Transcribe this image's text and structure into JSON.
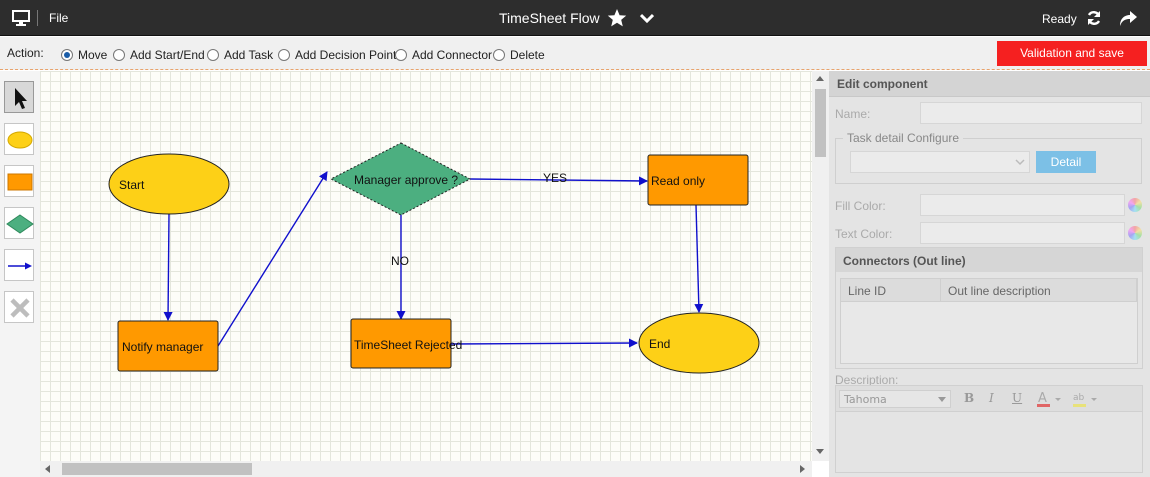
{
  "topbar": {
    "file_label": "File",
    "title": "TimeSheet Flow",
    "status": "Ready"
  },
  "actionbar": {
    "label": "Action:",
    "options": [
      {
        "label": "Move",
        "selected": true
      },
      {
        "label": "Add Start/End",
        "selected": false
      },
      {
        "label": "Add Task",
        "selected": false
      },
      {
        "label": "Add Decision Point",
        "selected": false
      },
      {
        "label": "Add Connector",
        "selected": false
      },
      {
        "label": "Delete",
        "selected": false
      }
    ],
    "validate_label": "Validation and save"
  },
  "toolbox": {
    "tools": [
      "pointer-tool",
      "start-end-tool",
      "task-tool",
      "decision-tool",
      "connector-tool",
      "delete-tool"
    ]
  },
  "flow": {
    "nodes": {
      "start": "Start",
      "notify": "Notify manager",
      "decision": "Manager approve ?",
      "readonly": "Read only",
      "rejected": "TimeSheet Rejected",
      "end": "End"
    },
    "edge_labels": {
      "yes": "YES",
      "no": "NO"
    }
  },
  "panel": {
    "title": "Edit component",
    "name_label": "Name:",
    "task_detail_legend": "Task detail Configure",
    "detail_button": "Detail",
    "fill_color_label": "Fill Color:",
    "text_color_label": "Text Color:",
    "connectors_title": "Connectors (Out line)",
    "columns": [
      "Line ID",
      "Out line description"
    ],
    "description_label": "Description:",
    "font_value": "Tahoma"
  },
  "colors": {
    "topbar": "#2d2d2d",
    "validate_button": "#f52020",
    "start_end_fill": "#fdd017",
    "task_fill": "#ff9900",
    "decision_fill": "#4caf80",
    "connector": "#1010cc",
    "detail_button": "#7cc0e6"
  }
}
